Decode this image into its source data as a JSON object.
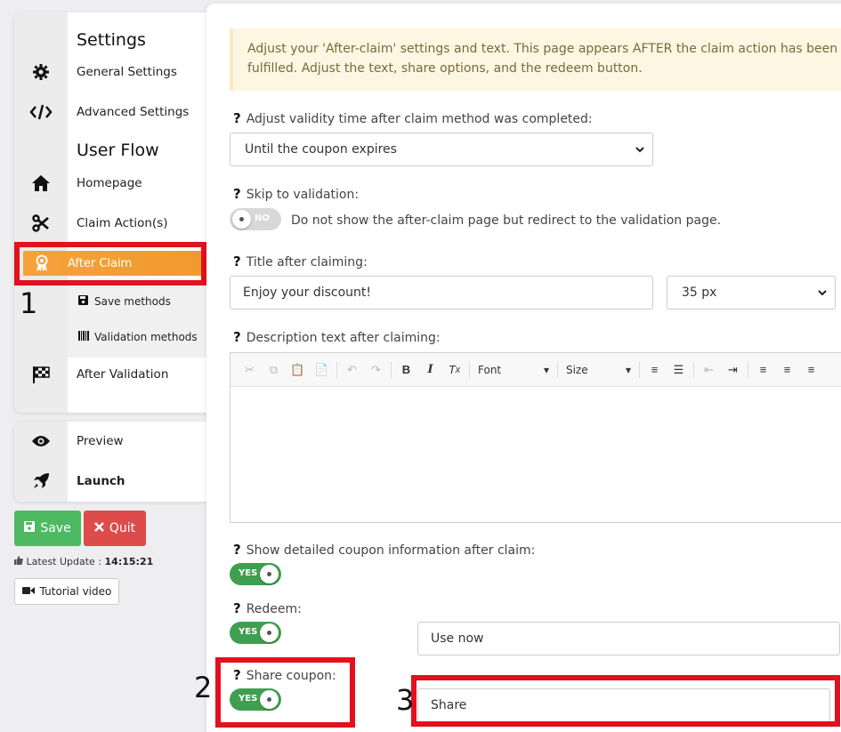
{
  "sidebar": {
    "settings_title": "Settings",
    "general_settings": "General Settings",
    "advanced_settings": "Advanced Settings",
    "user_flow_title": "User Flow",
    "homepage": "Homepage",
    "claim_actions": "Claim Action(s)",
    "after_claim": "After Claim",
    "save_methods": "Save methods",
    "validation_methods": "Validation methods",
    "after_validation": "After Validation",
    "preview": "Preview",
    "launch": "Launch"
  },
  "actions": {
    "save": "Save",
    "quit": "Quit",
    "latest_update_label": "Latest Update :",
    "latest_update_time": "14:15:21",
    "tutorial_video": "Tutorial video"
  },
  "markers": {
    "m1": "1",
    "m2": "2",
    "m3": "3"
  },
  "main": {
    "alert_text": "Adjust your 'After-claim' settings and text. This page appears AFTER the claim action has been fulfilled. Adjust the text, share options, and the redeem button.",
    "validity_label": "Adjust validity time after claim method was completed:",
    "validity_value": "Until the coupon expires",
    "skip_label": "Skip to validation:",
    "skip_toggle": "NO",
    "skip_help": "Do not show the after-claim page but redirect to the validation page.",
    "title_label": "Title after claiming:",
    "title_value": "Enjoy your discount!",
    "title_size": "35 px",
    "description_label": "Description text after claiming:",
    "editor": {
      "font": "Font",
      "size": "Size"
    },
    "show_details_label": "Show detailed coupon information after claim:",
    "show_details_toggle": "YES",
    "redeem_label": "Redeem:",
    "redeem_toggle": "YES",
    "redeem_value": "Use now",
    "share_label": "Share coupon:",
    "share_toggle": "YES",
    "share_value": "Share"
  },
  "colors": {
    "accent": "#f6a23a",
    "highlight": "#e3101d",
    "toggle_on": "#3f9f50",
    "save": "#4eb963",
    "quit": "#dd4b4b"
  }
}
